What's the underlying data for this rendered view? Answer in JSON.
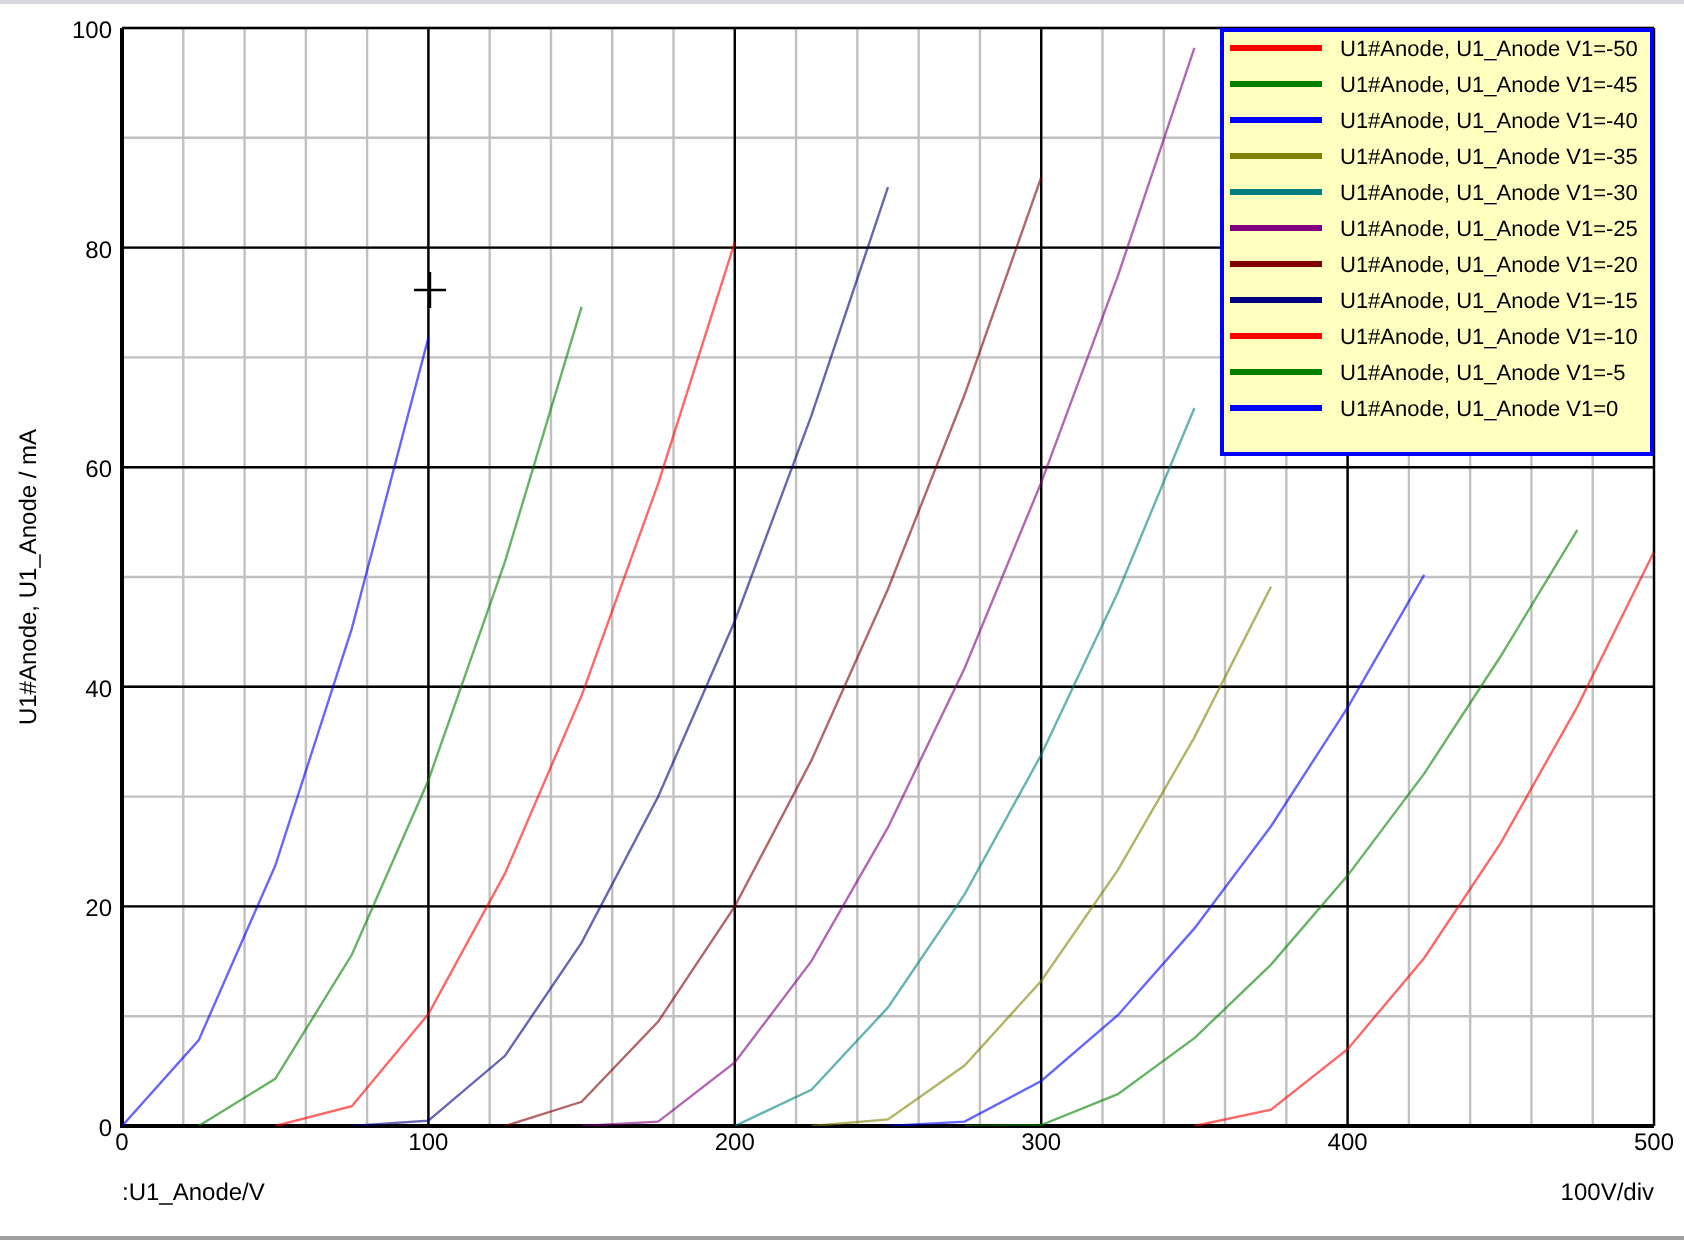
{
  "plot": {
    "chart_data": {
      "type": "line",
      "xlabel": ":U1_Anode/V",
      "ylabel": "U1#Anode, U1_Anode / mA",
      "x": [
        0,
        25,
        50,
        75,
        100,
        125,
        150,
        175,
        200,
        225,
        250,
        275,
        300,
        325,
        350,
        375,
        400,
        425,
        450,
        475,
        500
      ],
      "xlim": [
        0,
        500
      ],
      "ylim": [
        0,
        100
      ],
      "xticks": [
        0,
        100,
        200,
        300,
        400,
        500
      ],
      "yticks": [
        0,
        20,
        40,
        60,
        80,
        100
      ],
      "grid": true,
      "legend": true,
      "series": [
        {
          "name": "U1#Anode, U1_Anode V1=-50",
          "color": "#ff0000",
          "values": [
            null,
            null,
            null,
            null,
            null,
            null,
            null,
            null,
            null,
            null,
            null,
            null,
            null,
            null,
            0,
            1.5,
            7.0,
            15.3,
            25.8,
            38.2,
            52.3
          ]
        },
        {
          "name": "U1#Anode, U1_Anode V1=-45",
          "color": "#008000",
          "values": [
            null,
            null,
            null,
            null,
            null,
            null,
            null,
            null,
            null,
            null,
            null,
            0,
            0.1,
            2.9,
            8.0,
            14.7,
            22.8,
            32.1,
            42.8,
            54.3,
            null
          ]
        },
        {
          "name": "U1#Anode, U1_Anode V1=-40",
          "color": "#0000ff",
          "values": [
            null,
            null,
            null,
            null,
            null,
            null,
            null,
            null,
            null,
            null,
            0,
            0.4,
            4.1,
            10.1,
            18.0,
            27.3,
            38.1,
            50.2,
            null,
            null,
            null
          ]
        },
        {
          "name": "U1#Anode, U1_Anode V1=-35",
          "color": "#808000",
          "values": [
            null,
            null,
            null,
            null,
            null,
            null,
            null,
            null,
            null,
            0,
            0.6,
            5.5,
            13.2,
            23.3,
            35.4,
            49.1,
            null,
            null,
            null,
            null,
            null
          ]
        },
        {
          "name": "U1#Anode, U1_Anode V1=-30",
          "color": "#008080",
          "values": [
            null,
            null,
            null,
            null,
            null,
            null,
            null,
            null,
            0,
            3.3,
            10.8,
            21.1,
            33.8,
            48.6,
            65.4,
            null,
            null,
            null,
            null,
            null,
            null
          ]
        },
        {
          "name": "U1#Anode, U1_Anode V1=-25",
          "color": "#800080",
          "values": [
            null,
            null,
            null,
            null,
            null,
            null,
            0,
            0.4,
            5.8,
            15.0,
            27.2,
            41.7,
            58.6,
            77.4,
            98.2,
            null,
            null,
            null,
            null,
            null,
            null
          ]
        },
        {
          "name": "U1#Anode, U1_Anode V1=-20",
          "color": "#800000",
          "values": [
            null,
            null,
            null,
            null,
            null,
            0,
            2.2,
            9.5,
            20.0,
            33.3,
            48.9,
            66.6,
            86.4,
            null,
            null,
            null,
            null,
            null,
            null,
            null,
            null
          ]
        },
        {
          "name": "U1#Anode, U1_Anode V1=-15",
          "color": "#000080",
          "values": [
            null,
            null,
            null,
            0,
            0.5,
            6.4,
            16.7,
            30.0,
            46.0,
            64.7,
            85.5,
            null,
            null,
            null,
            null,
            null,
            null,
            null,
            null,
            null,
            null
          ]
        },
        {
          "name": "U1#Anode, U1_Anode V1=-10",
          "color": "#ff0000",
          "values": [
            null,
            null,
            0,
            1.8,
            10.2,
            23.0,
            39.2,
            58.5,
            80.5,
            null,
            null,
            null,
            null,
            null,
            null,
            null,
            null,
            null,
            null,
            null,
            null
          ]
        },
        {
          "name": "U1#Anode, U1_Anode V1=-5",
          "color": "#008000",
          "values": [
            null,
            0,
            4.3,
            15.6,
            31.5,
            51.4,
            74.6,
            null,
            null,
            null,
            null,
            null,
            null,
            null,
            null,
            null,
            null,
            null,
            null,
            null,
            null
          ]
        },
        {
          "name": "U1#Anode, U1_Anode V1=0",
          "color": "#0000ff",
          "values": [
            0,
            7.8,
            23.7,
            45.3,
            71.8,
            null,
            null,
            null,
            null,
            null,
            null,
            null,
            null,
            null,
            null,
            null,
            null,
            null,
            null,
            null,
            null
          ]
        }
      ]
    },
    "scale_label": "100V/div"
  }
}
